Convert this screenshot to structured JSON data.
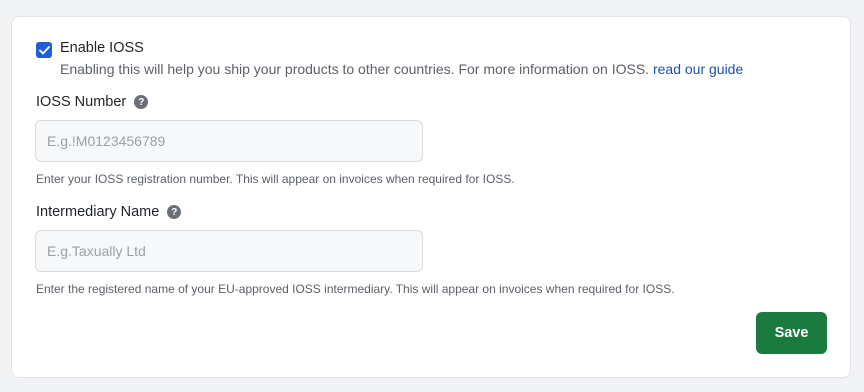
{
  "ioss": {
    "enabled": true,
    "enable_label": "Enable IOSS",
    "enable_description": "Enabling this will help you ship your products to other countries. For more information on IOSS.",
    "guide_link": "read our guide"
  },
  "ioss_number": {
    "label": "IOSS Number",
    "help_icon": "question-mark-icon",
    "placeholder": "E.g.!M0123456789",
    "value": "",
    "hint": "Enter your IOSS registration number. This will appear on invoices when required for IOSS."
  },
  "intermediary_name": {
    "label": "Intermediary Name",
    "help_icon": "question-mark-icon",
    "placeholder": "E.g.Taxually Ltd",
    "value": "",
    "hint": "Enter the registered name of your EU-approved IOSS intermediary. This will appear on invoices when required for IOSS."
  },
  "actions": {
    "save_label": "Save"
  },
  "colors": {
    "accent": "#1f5fd6",
    "link": "#1f4fa8",
    "save_button": "#1b7a3e"
  }
}
